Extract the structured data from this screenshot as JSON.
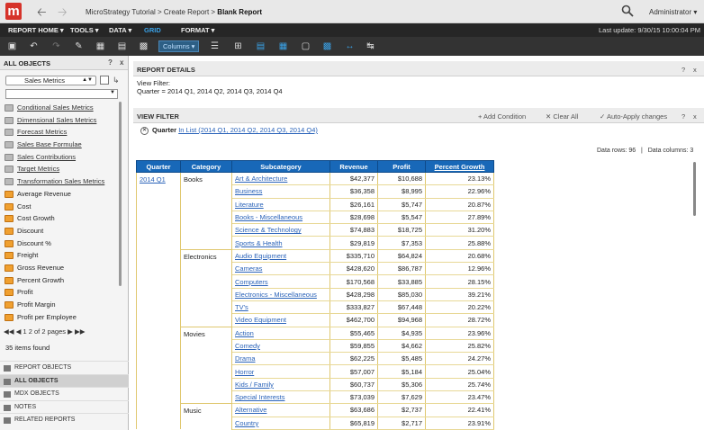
{
  "app": {
    "logo": "m",
    "breadcrumb": "MicroStrategy Tutorial > Create Report >",
    "title": "Blank Report",
    "user": "Administrator"
  },
  "menus": [
    {
      "label": "REPORT HOME ▾"
    },
    {
      "label": "TOOLS ▾"
    },
    {
      "label": "DATA ▾"
    },
    {
      "label": "GRID"
    },
    {
      "label": "FORMAT ▾"
    }
  ],
  "last_update": "Last update: 9/30/15 10:00:04 PM",
  "toolbar": {
    "columns_label": "Columns ▾"
  },
  "left": {
    "title": "ALL OBJECTS",
    "help": "?",
    "close": "x",
    "selector": "Sales Metrics",
    "search_value": "",
    "objects": [
      {
        "kind": "folder",
        "label": "Conditional Sales Metrics"
      },
      {
        "kind": "folder",
        "label": "Dimensional Sales Metrics"
      },
      {
        "kind": "folder",
        "label": "Forecast Metrics"
      },
      {
        "kind": "folder",
        "label": "Sales Base Formulae"
      },
      {
        "kind": "folder",
        "label": "Sales Contributions"
      },
      {
        "kind": "folder",
        "label": "Target Metrics"
      },
      {
        "kind": "folder",
        "label": "Transformation Sales Metrics"
      },
      {
        "kind": "metric",
        "label": "Average Revenue"
      },
      {
        "kind": "metric",
        "label": "Cost"
      },
      {
        "kind": "metric",
        "label": "Cost Growth"
      },
      {
        "kind": "metric",
        "label": "Discount"
      },
      {
        "kind": "metric",
        "label": "Discount %"
      },
      {
        "kind": "metric",
        "label": "Freight"
      },
      {
        "kind": "metric",
        "label": "Gross Revenue"
      },
      {
        "kind": "metric",
        "label": "Percent Growth"
      },
      {
        "kind": "metric",
        "label": "Profit"
      },
      {
        "kind": "metric",
        "label": "Profit Margin"
      },
      {
        "kind": "metric",
        "label": "Profit per Employee"
      }
    ],
    "pager": "1 2  of 2 pages",
    "items_found": "35 items found",
    "nav": [
      {
        "label": "REPORT OBJECTS"
      },
      {
        "label": "ALL OBJECTS"
      },
      {
        "label": "MDX OBJECTS"
      },
      {
        "label": "NOTES"
      },
      {
        "label": "RELATED REPORTS"
      }
    ]
  },
  "report_details": {
    "title": "REPORT DETAILS",
    "view_filter_label": "View Filter:",
    "view_filter_text": "Quarter = 2014 Q1, 2014 Q2, 2014 Q3, 2014 Q4",
    "help": "?",
    "close": "x"
  },
  "view_filter": {
    "title": "VIEW FILTER",
    "add_condition": "+ Add Condition",
    "clear_all": "✕ Clear All",
    "auto_apply": "✓ Auto-Apply changes",
    "help": "?",
    "close": "x",
    "field": "Quarter",
    "condition": "In List (2014 Q1, 2014 Q2, 2014 Q3, 2014 Q4)"
  },
  "data_info": {
    "rows": "Data rows: 96",
    "columns": "Data columns: 3"
  },
  "grid": {
    "headers": [
      "Quarter",
      "Category",
      "Subcategory",
      "Revenue",
      "Profit",
      "Percent Growth"
    ],
    "rows": [
      {
        "q": "2014 Q1",
        "cat": "Books",
        "sub": "Art & Architecture",
        "rev": "$42,377",
        "profit": "$10,688",
        "pg": "23.13%"
      },
      {
        "q": "",
        "cat": "",
        "sub": "Business",
        "rev": "$36,358",
        "profit": "$8,995",
        "pg": "22.96%"
      },
      {
        "q": "",
        "cat": "",
        "sub": "Literature",
        "rev": "$26,161",
        "profit": "$5,747",
        "pg": "20.87%"
      },
      {
        "q": "",
        "cat": "",
        "sub": "Books - Miscellaneous",
        "rev": "$28,698",
        "profit": "$5,547",
        "pg": "27.89%"
      },
      {
        "q": "",
        "cat": "",
        "sub": "Science & Technology",
        "rev": "$74,883",
        "profit": "$18,725",
        "pg": "31.20%"
      },
      {
        "q": "",
        "cat": "",
        "sub": "Sports & Health",
        "rev": "$29,819",
        "profit": "$7,353",
        "pg": "25.88%"
      },
      {
        "q": "",
        "cat": "Electronics",
        "sub": "Audio Equipment",
        "rev": "$335,710",
        "profit": "$64,824",
        "pg": "20.68%"
      },
      {
        "q": "",
        "cat": "",
        "sub": "Cameras",
        "rev": "$428,620",
        "profit": "$86,787",
        "pg": "12.96%"
      },
      {
        "q": "",
        "cat": "",
        "sub": "Computers",
        "rev": "$170,568",
        "profit": "$33,885",
        "pg": "28.15%"
      },
      {
        "q": "",
        "cat": "",
        "sub": "Electronics - Miscellaneous",
        "rev": "$428,298",
        "profit": "$85,030",
        "pg": "39.21%"
      },
      {
        "q": "",
        "cat": "",
        "sub": "TV's",
        "rev": "$333,827",
        "profit": "$67,448",
        "pg": "20.22%"
      },
      {
        "q": "",
        "cat": "",
        "sub": "Video Equipment",
        "rev": "$462,700",
        "profit": "$94,968",
        "pg": "28.72%"
      },
      {
        "q": "",
        "cat": "Movies",
        "sub": "Action",
        "rev": "$55,465",
        "profit": "$4,935",
        "pg": "23.96%"
      },
      {
        "q": "",
        "cat": "",
        "sub": "Comedy",
        "rev": "$59,855",
        "profit": "$4,662",
        "pg": "25.82%"
      },
      {
        "q": "",
        "cat": "",
        "sub": "Drama",
        "rev": "$62,225",
        "profit": "$5,485",
        "pg": "24.27%"
      },
      {
        "q": "",
        "cat": "",
        "sub": "Horror",
        "rev": "$57,007",
        "profit": "$5,184",
        "pg": "25.04%"
      },
      {
        "q": "",
        "cat": "",
        "sub": "Kids / Family",
        "rev": "$60,737",
        "profit": "$5,306",
        "pg": "25.74%"
      },
      {
        "q": "",
        "cat": "",
        "sub": "Special Interests",
        "rev": "$73,039",
        "profit": "$7,629",
        "pg": "23.47%"
      },
      {
        "q": "",
        "cat": "Music",
        "sub": "Alternative",
        "rev": "$63,686",
        "profit": "$2,737",
        "pg": "22.41%"
      },
      {
        "q": "",
        "cat": "",
        "sub": "Country",
        "rev": "$65,819",
        "profit": "$2,717",
        "pg": "23.91%"
      }
    ]
  }
}
